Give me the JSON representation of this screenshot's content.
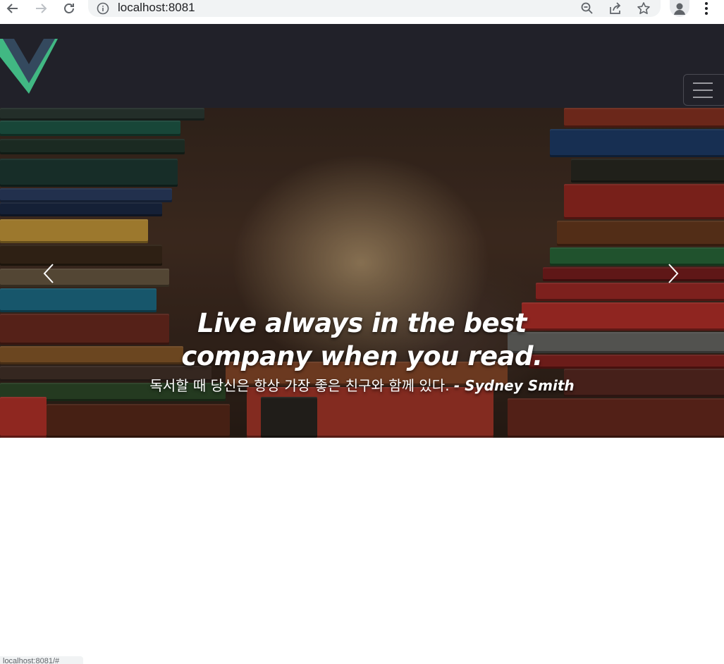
{
  "browser": {
    "url": "localhost:8081",
    "status_url": "localhost:8081/#"
  },
  "icons": {
    "back": "arrow-left-icon",
    "forward": "arrow-right-icon",
    "reload": "reload-icon",
    "info": "info-icon",
    "zoom": "zoom-icon",
    "share": "share-icon",
    "bookmark": "star-icon",
    "profile": "avatar-icon",
    "menu": "kebab-menu-icon",
    "logo": "vue-logo-icon",
    "toggler": "hamburger-icon",
    "prev": "chevron-left-icon",
    "next": "chevron-right-icon"
  },
  "colors": {
    "navbar": "#212129",
    "vue_green": "#41b883",
    "vue_dark": "#34495e"
  },
  "carousel": {
    "title": "Live always in the best company when you read.",
    "subtitle": "독서할 때 당신은 항상 가장 좋은 친구와 함께 있다.",
    "author": "- Sydney Smith"
  }
}
